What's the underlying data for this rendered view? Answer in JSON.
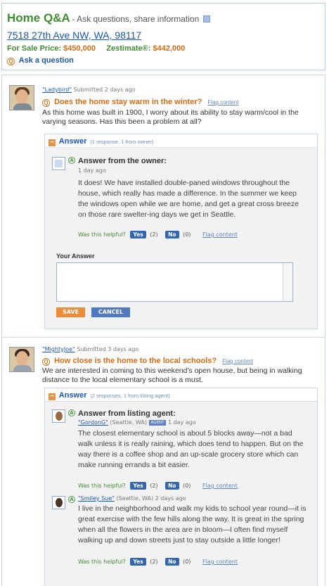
{
  "header": {
    "title": "Home Q&A",
    "subtitle": "- Ask questions, share information",
    "address": "7518 27th Ave NW, WA, 98117",
    "sale_price_label": "For Sale Price:",
    "sale_price": "$450,000",
    "zestimate_label": "Zestimate®:",
    "zestimate": "$442,000",
    "ask_question": "Ask a question"
  },
  "questions": [
    {
      "user": "\"Ladybird\"",
      "submitted": "Submitted 2 days ago",
      "title": "Does the home stay warm in the winter?",
      "flag": "Flag content",
      "body": "As this home was built in 1900, I worry about its ability to stay warm/cool in the varying seasons.  Has this been a problem at all?",
      "answer_label": "Answer",
      "answer_count": "(1 response, 1 from owner)",
      "answers": [
        {
          "title": "Answer from the owner:",
          "time": "1 day ago",
          "body": "It does!  We have installed double-paned windows throughout the house, which really has made a difference. In the summer we keep the windows open while we are home, and get a great cross breeze on those rare swelter-ing days we get in Seattle.",
          "helpful": "Was this helpful?",
          "yes": "Yes",
          "yes_count": "(2)",
          "no": "No",
          "no_count": "(0)",
          "flag": "Flag content"
        }
      ],
      "your_answer_label": "Your Answer",
      "save": "SAVE",
      "cancel": "CANCEL"
    },
    {
      "user": "\"MightyJoe\"",
      "submitted": "Submitted 3 days ago",
      "title": "How close is the home to the local schools?",
      "flag": "Flag content",
      "body": "We are interested in coming to this weekend's open house, but being in walking distance to the local elementary school is a must.",
      "answer_label": "Answer",
      "answer_count": "(2 responses, 1 from listing agent)",
      "answers": [
        {
          "title": "Answer from listing agent:",
          "user": "\"GordonG\"",
          "location": "(Seattle, WA)",
          "badge": "AGENT",
          "time": "1 day ago",
          "body": "The closest elementary school is about 5 blocks away—not a bad walk unless it is really raining, which does tend to happen.  But on the way there is a coffee shop and an up-scale grocery store which can make running errands a bit easier.",
          "helpful": "Was this helpful?",
          "yes": "Yes",
          "yes_count": "(2)",
          "no": "No",
          "no_count": "(0)",
          "flag": "Flag content"
        },
        {
          "user": "\"Smiley Sue\"",
          "location": "(Seattle, WA)",
          "time": "2 days ago",
          "body": "I live in the neighborhood and walk my kids to school year round—it is great exercise with the few hills along the way. It is great in the spring when all the flowers in the area are in bloom—I often find myself walking up and down streets just to stay outside a little longer!",
          "helpful": "Was this helpful?",
          "yes": "Yes",
          "yes_count": "(2)",
          "no": "No",
          "no_count": "(0)",
          "flag": "Flag content"
        }
      ]
    }
  ]
}
